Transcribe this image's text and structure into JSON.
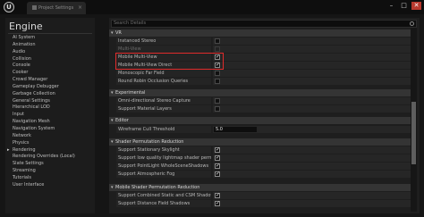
{
  "window": {
    "tab_title": "Project Settings",
    "tab_close": "×",
    "minimize": "–",
    "maximize": "□",
    "close": "✕"
  },
  "logo": "U",
  "left": {
    "title": "Engine",
    "items": [
      "AI System",
      "Animation",
      "Audio",
      "Collision",
      "Console",
      "Cooker",
      "Crowd Manager",
      "Gameplay Debugger",
      "Garbage Collection",
      "General Settings",
      "Hierarchical LOD",
      "Input",
      "Navigation Mesh",
      "Navigation System",
      "Network",
      "Physics",
      "Rendering",
      "Rendering Overrides (Local)",
      "Slate Settings",
      "Streaming",
      "Tutorials",
      "User Interface"
    ],
    "current": "Rendering"
  },
  "search": {
    "placeholder": "Search Details"
  },
  "sections": {
    "vr": "VR",
    "experimental": "Experimental",
    "editor": "Editor",
    "shader_perm": "Shader Permutation Reduction",
    "mobile_shader_perm": "Mobile Shader Permutation Reduction"
  },
  "rows": {
    "instanced_stereo": "Instanced Stereo",
    "multi_view": "Multi-View",
    "mobile_multi_view": "Mobile Multi-View",
    "mobile_multi_view_direct": "Mobile Multi-View Direct",
    "monoscopic_far_field": "Monoscopic Far Field",
    "round_robin_occlusion": "Round Robin Occlusion Queries",
    "omni_shadow_capture": "Omni-directional Stereo Capture",
    "support_material_layers": "Support Material Layers",
    "wireframe_cull_threshold": "Wireframe Cull Threshold",
    "wireframe_cull_value": "5.0",
    "stationary_skylight": "Support Stationary Skylight",
    "low_quality_lightmap": "Support low quality lightmap shader permutations",
    "pointlight_wholescene": "Support PointLight WholeSceneShadows",
    "atmospheric_fog": "Support Atmospheric Fog",
    "combined_static_csm": "Support Combined Static and CSM Shadowing",
    "distance_field_shadows": "Support Distance Field Shadows"
  },
  "checks": {
    "instanced_stereo": false,
    "multi_view": false,
    "mobile_multi_view": true,
    "mobile_multi_view_direct": true,
    "monoscopic_far_field": false,
    "round_robin_occlusion": false,
    "omni_shadow_capture": false,
    "support_material_layers": false,
    "stationary_skylight": true,
    "low_quality_lightmap": true,
    "pointlight_wholescene": true,
    "atmospheric_fog": true,
    "combined_static_csm": true,
    "distance_field_shadows": true
  },
  "colors": {
    "highlight": "#e02b2b",
    "background": "#151515"
  }
}
